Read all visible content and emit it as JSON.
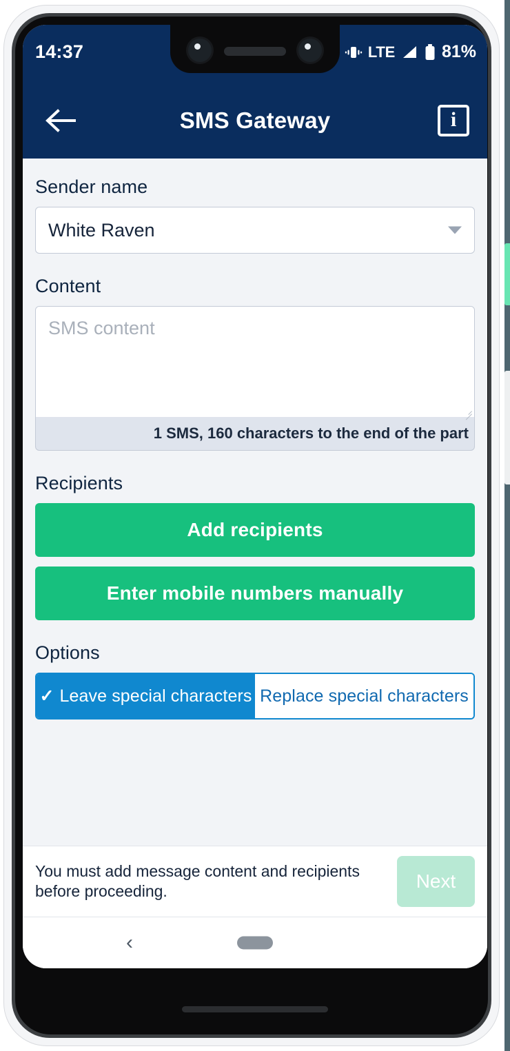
{
  "status_bar": {
    "time": "14:37",
    "network": "LTE",
    "battery_percent": "81%",
    "vibrate_icon": "vibrate-icon",
    "signal_icon": "signal-bars-icon",
    "battery_icon": "battery-icon"
  },
  "app_bar": {
    "title": "SMS Gateway",
    "back_icon": "back-arrow-icon",
    "info_icon": "info-icon",
    "info_glyph": "i",
    "background_color": "#0a2d5e"
  },
  "form": {
    "sender": {
      "label": "Sender name",
      "value": "White Raven",
      "caret_icon": "chevron-down-icon"
    },
    "content": {
      "label": "Content",
      "placeholder": "SMS content",
      "value": "",
      "counter": "1 SMS, 160 characters to the end of the part"
    },
    "recipients": {
      "label": "Recipients",
      "add_button": "Add recipients",
      "manual_button": "Enter mobile numbers manually",
      "button_color": "#17c07e"
    },
    "options": {
      "label": "Options",
      "segments": [
        {
          "label": "Leave special characters",
          "selected": true,
          "check": "✓"
        },
        {
          "label": "Replace special characters",
          "selected": false
        }
      ],
      "accent_color": "#1088cf"
    }
  },
  "action_bar": {
    "warning": "You must add message content and recipients before proceeding.",
    "next_label": "Next",
    "next_disabled_color": "#b8e9d4"
  },
  "nav_bar": {
    "back_glyph": "‹",
    "back_icon": "nav-back-icon",
    "home_icon": "home-pill-icon"
  }
}
